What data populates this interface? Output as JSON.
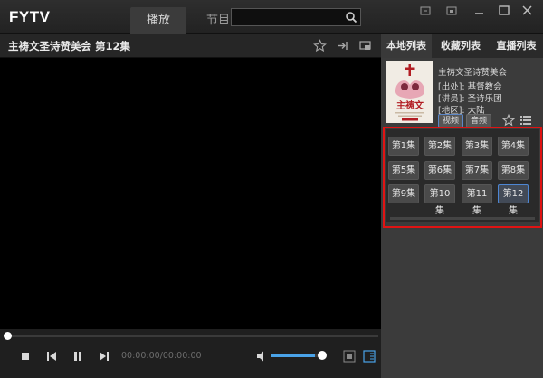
{
  "app": {
    "title": "FYTV"
  },
  "tabs": [
    {
      "label": "播放",
      "active": true
    },
    {
      "label": "节目",
      "active": false
    }
  ],
  "search": {
    "value": "",
    "placeholder": ""
  },
  "player": {
    "title": "主祷文圣诗赞美会 第12集",
    "time": "00:00:00/00:00:00",
    "progress": 0.0,
    "volume": 0.85
  },
  "panel": {
    "tabs": [
      {
        "label": "本地列表",
        "active": true
      },
      {
        "label": "收藏列表",
        "active": false
      },
      {
        "label": "直播列表",
        "active": false
      }
    ],
    "info": {
      "title": "主祷文圣诗赞美会",
      "source": "[出处]: 基督教会",
      "speaker": "[讲员]: 圣诗乐团",
      "region": "[地区]: 大陆",
      "video_label": "视频",
      "audio_label": "音频"
    },
    "episodes": [
      {
        "label": "第1集",
        "active": false
      },
      {
        "label": "第2集",
        "active": false
      },
      {
        "label": "第3集",
        "active": false
      },
      {
        "label": "第4集",
        "active": false
      },
      {
        "label": "第5集",
        "active": false
      },
      {
        "label": "第6集",
        "active": false
      },
      {
        "label": "第7集",
        "active": false
      },
      {
        "label": "第8集",
        "active": false
      },
      {
        "label": "第9集",
        "active": false
      },
      {
        "label": "第10集",
        "active": false
      },
      {
        "label": "第11集",
        "active": false
      },
      {
        "label": "第12集",
        "active": true
      }
    ]
  },
  "colors": {
    "accent": "#4aa3e8",
    "highlight": "#e01313",
    "background": "#1b1b1b"
  },
  "icons": [
    "search-icon",
    "star-icon",
    "pin-icon",
    "screen-icon",
    "stop-icon",
    "prev-icon",
    "pause-icon",
    "next-icon",
    "volume-icon",
    "fullscreen-icon",
    "playlist-icon",
    "list-icon"
  ]
}
